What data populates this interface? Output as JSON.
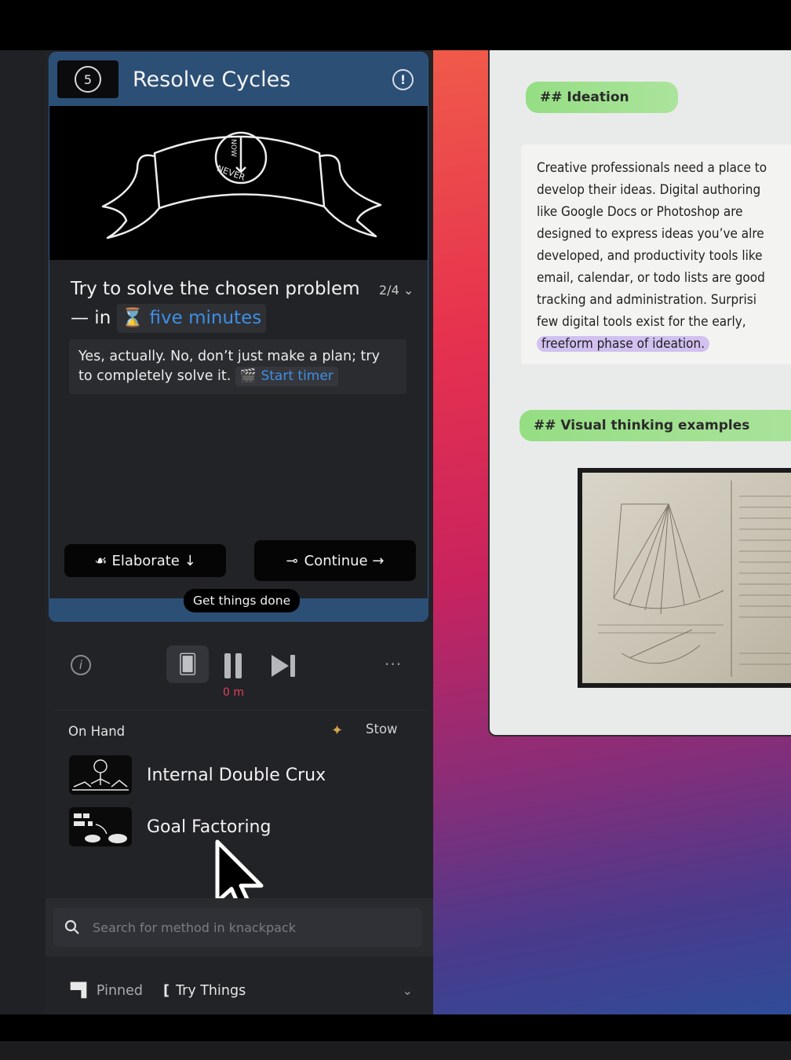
{
  "card": {
    "timer_number": "5",
    "title": "Resolve Cycles",
    "alert_symbol": "!",
    "prompt_text": "Try to solve the chosen problem — in",
    "prompt_chip": "five minutes",
    "step": "2/4 ⌄",
    "hint_text": "Yes, actually. No, don’t just make a plan; try to completely solve it.",
    "hint_chip": "Start timer",
    "elaborate_label": "Elaborate ↓",
    "continue_label": "Continue →",
    "tag": "Get things done"
  },
  "player": {
    "elapsed": "0 m",
    "more": "···"
  },
  "onhand": {
    "label": "On Hand",
    "stow": "Stow",
    "items": [
      {
        "label": "Internal Double Crux"
      },
      {
        "label": "Goal Factoring"
      }
    ]
  },
  "search": {
    "placeholder": "Search for method in knackpack"
  },
  "tabs": {
    "pinned": "Pinned",
    "try": "Try Things"
  },
  "doc": {
    "heading1": "## Ideation",
    "paragraph_lines": [
      "Creative professionals need a place to",
      "develop their ideas. Digital authoring",
      "like Google Docs or Photoshop are",
      "designed to express ideas you’ve alre",
      "developed, and productivity tools like",
      "email, calendar, or todo lists are good",
      "tracking and administration. Surprisi",
      "few digital tools exist for the early,"
    ],
    "highlight_line": "freeform phase of ideation.",
    "heading2": "## Visual thinking examples"
  },
  "colors": {
    "accent_blue": "#2c4f76",
    "link_blue": "#3d8fe6",
    "elapsed_red": "#e0405a"
  }
}
